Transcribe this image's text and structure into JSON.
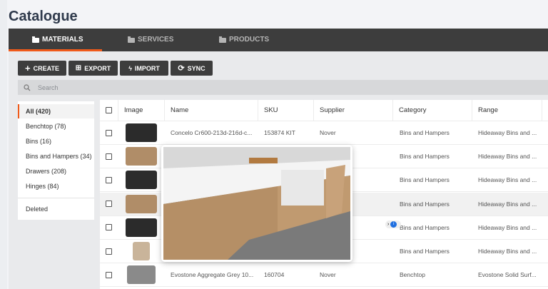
{
  "page": {
    "title": "Catalogue"
  },
  "tabs": [
    {
      "label": "MATERIALS",
      "active": true
    },
    {
      "label": "SERVICES"
    },
    {
      "label": "PRODUCTS"
    }
  ],
  "toolbar": {
    "create": "CREATE",
    "export": "EXPORT",
    "import": "IMPORT",
    "sync": "SYNC"
  },
  "search": {
    "placeholder": "Search"
  },
  "sidebar": {
    "items": [
      {
        "label": "All (420)",
        "active": true
      },
      {
        "label": "Benchtop (78)"
      },
      {
        "label": "Bins (16)"
      },
      {
        "label": "Bins and Hampers (34)"
      },
      {
        "label": "Drawers (208)"
      },
      {
        "label": "Hinges (84)"
      },
      {
        "label": "Deleted"
      }
    ]
  },
  "table": {
    "headers": [
      "Image",
      "Name",
      "SKU",
      "Supplier",
      "Category",
      "Range"
    ],
    "rows": [
      {
        "name": "Concelo Cr600-213d-216d-c...",
        "sku": "153874 KIT",
        "supplier": "Nover",
        "category": "Bins and Hampers",
        "range": "Hideaway Bins and ..."
      },
      {
        "name": "",
        "sku": "",
        "supplier": "",
        "category": "Bins and Hampers",
        "range": "Hideaway Bins and ..."
      },
      {
        "name": "",
        "sku": "",
        "supplier": "",
        "category": "Bins and Hampers",
        "range": "Hideaway Bins and ..."
      },
      {
        "name": "",
        "sku": "",
        "supplier": "",
        "category": "Bins and Hampers",
        "range": "Hideaway Bins and ..."
      },
      {
        "name": "",
        "sku": "",
        "supplier": "",
        "category": "Bins and Hampers",
        "range": "Hideaway Bins and ..."
      },
      {
        "name": "",
        "sku": "",
        "supplier": "",
        "category": "Bins and Hampers",
        "range": "Hideaway Bins and ..."
      },
      {
        "name": "Evostone Aggregate Grey 10...",
        "sku": "160704",
        "supplier": "Nover",
        "category": "Benchtop",
        "range": "Evostone Solid Surf..."
      }
    ]
  },
  "colors": {
    "accent": "#f05a1a",
    "tabbar": "#3d3d3d"
  }
}
